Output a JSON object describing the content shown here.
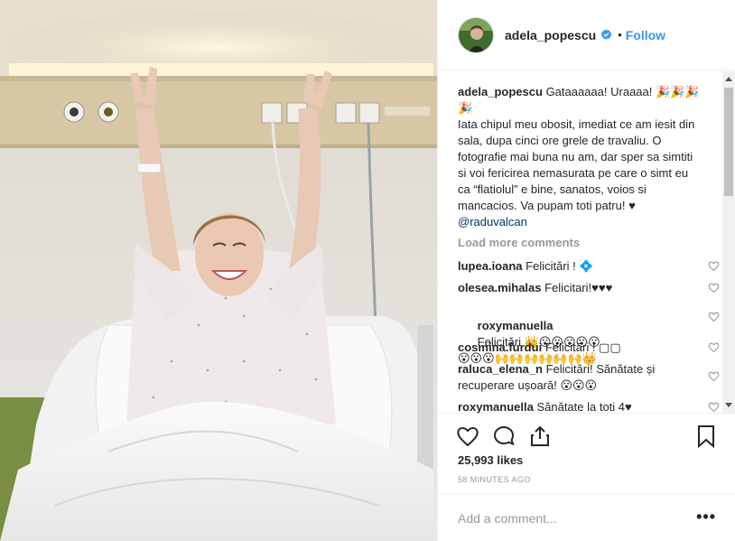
{
  "post": {
    "username": "adela_popescu",
    "verified": true,
    "follow_label": "Follow",
    "dot": "•",
    "caption": {
      "username": "adela_popescu",
      "text": "Gataaaaaa! Uraaaa! 🎉🎉🎉\n🎉\nIata chipul meu obosit, imediat ce am iesit din sala, dupa cinci ore grele de travaliu. O fotografie mai buna nu am, dar sper sa simtiti si voi fericirea nemasurata pe care o simt eu ca “flatiolul” e bine, sanatos, voios si mancacios. Va pupam toti patru! ♥",
      "mention": "@raduvalcan"
    },
    "load_more_label": "Load more comments",
    "comments": [
      {
        "username": "lupea.ioana",
        "text": "Felicitări ! 💠"
      },
      {
        "username": "olesea.mihalas",
        "text": "Felicitari!♥♥♥"
      },
      {
        "username": "roxymanuella",
        "text": "Felicitări 👑😮😮😮😮😮\n😮😮😮🙌🙌🙌🙌🙌🙌👑"
      },
      {
        "username": "cosmina.furdui",
        "text": "Felicitări ! ▢▢"
      },
      {
        "username": "raluca_elena_n",
        "text": "Felicitări! Sănătate și recuperare ușoară! 😮😮😮"
      },
      {
        "username": "roxymanuella",
        "text": "Sănătate la toti 4♥"
      }
    ],
    "likes": "25,993 likes",
    "time": "58 MINUTES AGO",
    "comment_placeholder": "Add a comment...",
    "more_label": "•••"
  },
  "icons": {
    "like": "heart-icon",
    "comment": "comment-icon",
    "share": "share-icon",
    "save": "bookmark-icon",
    "verified": "verified-badge-icon",
    "comment_like": "heart-outline-icon",
    "more": "more-options-icon"
  },
  "colors": {
    "link_blue": "#3897f0",
    "mention_blue": "#003569",
    "muted": "#999999",
    "text": "#262626",
    "border": "#efefef"
  }
}
